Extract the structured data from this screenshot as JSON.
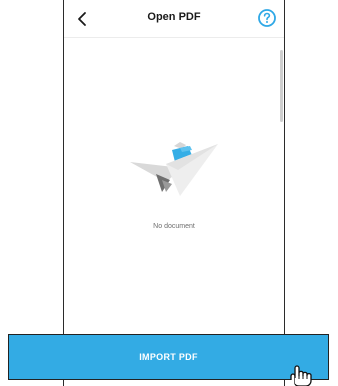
{
  "header": {
    "title": "Open PDF",
    "back_icon": "chevron-left-icon",
    "help_icon": "question-circle-icon"
  },
  "content": {
    "empty_message": "No document",
    "illustration": "paper-plane-icon"
  },
  "actions": {
    "import_label": "IMPORT PDF"
  },
  "cursor": {
    "icon": "hand-pointer-icon"
  },
  "colors": {
    "accent": "#33abe4",
    "help_icon": "#2fa8e6"
  }
}
